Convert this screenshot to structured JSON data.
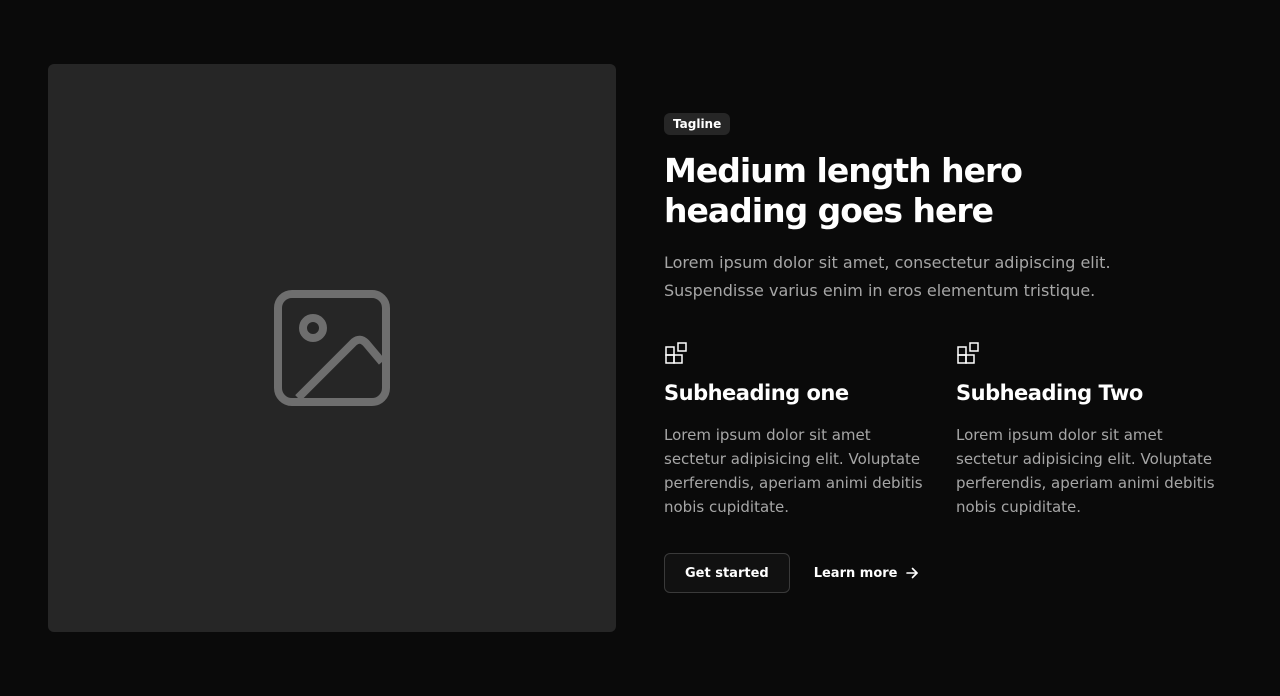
{
  "media": {
    "icon": "image-placeholder-icon"
  },
  "hero": {
    "tagline": "Tagline",
    "title": "Medium length hero heading goes here",
    "description": "Lorem ipsum dolor sit amet, consectetur adipiscing elit. Suspendisse varius enim in eros elementum tristique."
  },
  "features": [
    {
      "icon": "blocks-icon",
      "title": "Subheading one",
      "text": "Lorem ipsum dolor sit amet sectetur adipisicing elit. Voluptate perferendis, aperiam animi debitis nobis cupiditate."
    },
    {
      "icon": "blocks-icon",
      "title": "Subheading Two",
      "text": "Lorem ipsum dolor sit amet sectetur adipisicing elit. Voluptate perferendis, aperiam animi debitis nobis cupiditate."
    }
  ],
  "actions": {
    "primary_label": "Get started",
    "secondary_label": "Learn more",
    "secondary_icon": "arrow-right-icon"
  },
  "colors": {
    "background": "#0a0a0a",
    "panel": "#262626",
    "text": "#ffffff",
    "muted_text": "#a6a6a6"
  }
}
